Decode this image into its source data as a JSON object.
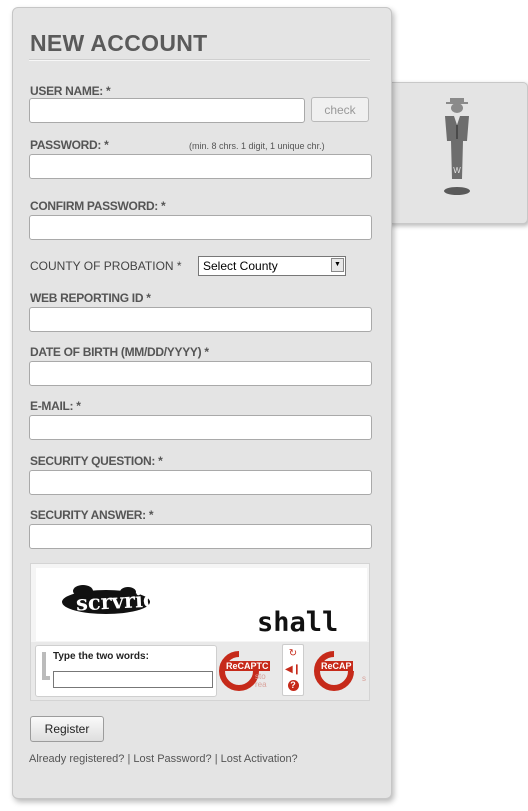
{
  "form": {
    "title": "NEW ACCOUNT",
    "username_label": "USER NAME: *",
    "username_value": "",
    "check_label": "check",
    "password_label": "PASSWORD: *",
    "password_hint": "(min. 8 chrs. 1 digit, 1 unique chr.)",
    "confirm_label": "CONFIRM PASSWORD: *",
    "county_label": "COUNTY OF PROBATION *",
    "county_selected": "Select County",
    "web_id_label": "WEB REPORTING ID *",
    "dob_label": "DATE OF BIRTH (MM/DD/YYYY) *",
    "email_label": "E-MAIL: *",
    "sec_question_label": "SECURITY QUESTION: *",
    "sec_answer_label": "SECURITY ANSWER: *",
    "register_label": "Register"
  },
  "captcha": {
    "word1": "scrvride",
    "word2": "shall",
    "prompt": "Type the two words:",
    "brand_re": "Re",
    "brand_name": "CAPTC",
    "brand_sub1": "sto",
    "brand_sub2": "rea",
    "brand2_name": "CAP",
    "brand2_sub": "s"
  },
  "links": {
    "registered": "Already registered?",
    "lost_password": "Lost Password?",
    "lost_activation": "Lost Activation?",
    "sep": "|"
  },
  "icons": {
    "side_figure": "agent-figure-icon",
    "refresh": "refresh-icon",
    "audio": "audio-icon",
    "help": "help-icon"
  },
  "colors": {
    "panel_bg": "#e4e4e4",
    "label_text": "#555555",
    "captcha_red": "#c62a1a"
  }
}
